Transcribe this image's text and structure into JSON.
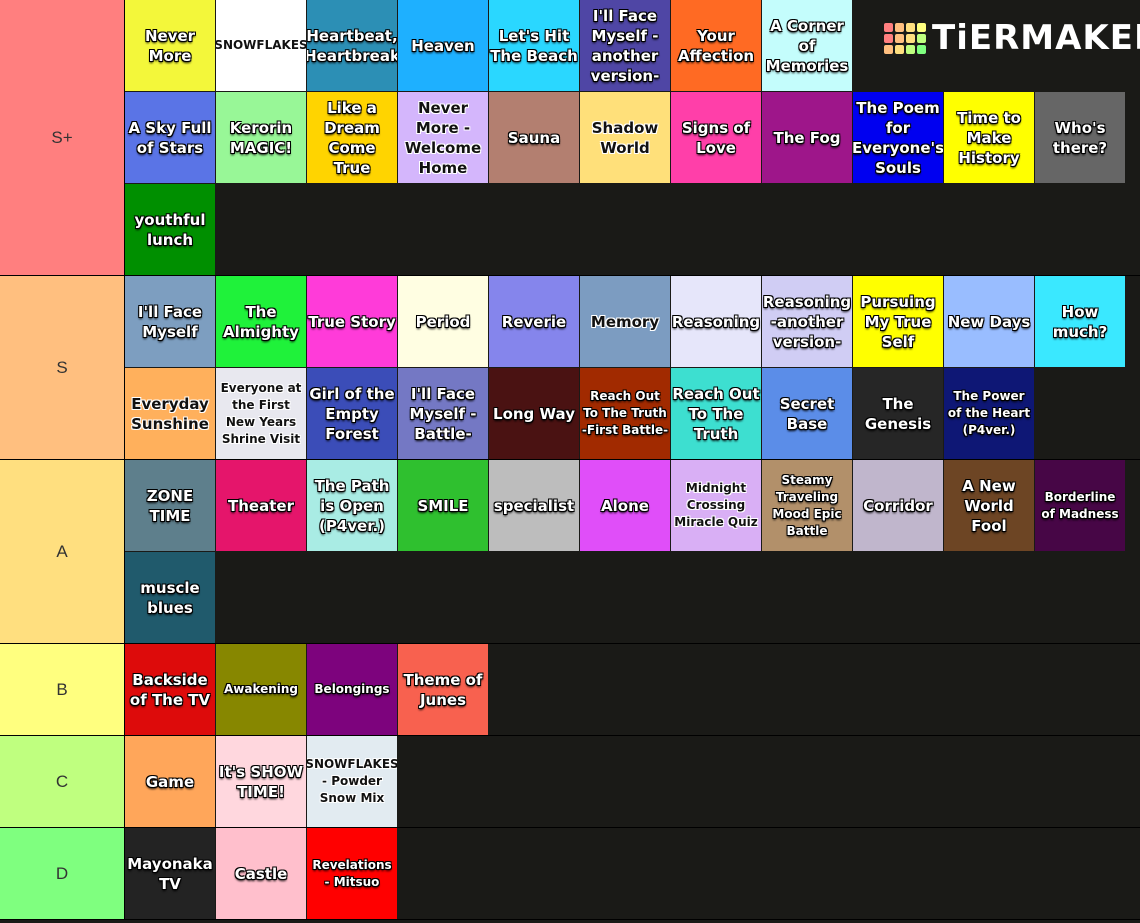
{
  "logo": {
    "text": "TiERMAKER",
    "colors": [
      "#ff7f7f",
      "#ffbf7f",
      "#ffdf7f",
      "#ffff7f",
      "#ff7f7f",
      "#ffbf7f",
      "#ffdf7f",
      "#bfff7f",
      "#ffbf7f",
      "#ffdf7f",
      "#bfff7f",
      "#7fff7f"
    ]
  },
  "tiers": [
    {
      "label": "S+",
      "color": "#ff7f7f",
      "rows": 3,
      "tiles": [
        {
          "t": "Never More",
          "bg": "#f3f73a"
        },
        {
          "t": "SNOWFLAKES",
          "bg": "#ffffff",
          "dark": true,
          "small": true
        },
        {
          "t": "Heartbeat, Heartbreak",
          "bg": "#2c8fb5"
        },
        {
          "t": "Heaven",
          "bg": "#1eb0ff"
        },
        {
          "t": "Let's Hit The Beach",
          "bg": "#2ad7ff"
        },
        {
          "t": "I'll Face Myself -another version-",
          "bg": "#4f46a5"
        },
        {
          "t": "Your Affection",
          "bg": "#ff6a23"
        },
        {
          "t": "A Corner of Memories",
          "bg": "#c4fdfc"
        },
        {
          "t": "",
          "bg": "#1a1a17"
        },
        {
          "t": "",
          "bg": "#1a1a17"
        },
        {
          "t": "",
          "bg": "#1a1a17"
        },
        {
          "t": "A Sky Full of Stars",
          "bg": "#5a74e6"
        },
        {
          "t": "Kerorin MAGIC!",
          "bg": "#98f797"
        },
        {
          "t": "Like a Dream Come True",
          "bg": "#ffd400"
        },
        {
          "t": "Never More - Welcome Home",
          "bg": "#d4b6fc",
          "dark": true
        },
        {
          "t": "Sauna",
          "bg": "#b37f70"
        },
        {
          "t": "Shadow World",
          "bg": "#ffe07a",
          "dark": true
        },
        {
          "t": "Signs of Love",
          "bg": "#ff3fa9"
        },
        {
          "t": "The Fog",
          "bg": "#9e168a"
        },
        {
          "t": "The Poem for Everyone's Souls",
          "bg": "#0000f0"
        },
        {
          "t": "Time to Make History",
          "bg": "#ffff00"
        },
        {
          "t": "Who's there?",
          "bg": "#666666"
        },
        {
          "t": "youthful lunch",
          "bg": "#008f00"
        }
      ]
    },
    {
      "label": "S",
      "color": "#ffbf7f",
      "rows": 2,
      "tiles": [
        {
          "t": "I'll Face Myself",
          "bg": "#7d9ec0"
        },
        {
          "t": "The Almighty",
          "bg": "#1ff23a"
        },
        {
          "t": "True Story",
          "bg": "#ff3bd9"
        },
        {
          "t": "Period",
          "bg": "#fffee2"
        },
        {
          "t": "Reverie",
          "bg": "#8585ec"
        },
        {
          "t": "Memory",
          "bg": "#7c9cc1",
          "dark": true
        },
        {
          "t": "Reasoning",
          "bg": "#e6e6fa"
        },
        {
          "t": "Reasoning -another version-",
          "bg": "#d0cdf4"
        },
        {
          "t": "Pursuing My True Self",
          "bg": "#ffff00"
        },
        {
          "t": "New Days",
          "bg": "#99bdff"
        },
        {
          "t": "How much?",
          "bg": "#3ae8ff"
        },
        {
          "t": "Everyday Sunshine",
          "bg": "#ffb05c",
          "dark": true
        },
        {
          "t": "Everyone at the First New Years Shrine Visit",
          "bg": "#e8e8ef",
          "dark": true,
          "small": true
        },
        {
          "t": "Girl of the Empty Forest",
          "bg": "#3b4db8"
        },
        {
          "t": "I'll Face Myself -Battle-",
          "bg": "#7478c4"
        },
        {
          "t": "Long Way",
          "bg": "#4a1212"
        },
        {
          "t": "Reach Out To The Truth -First Battle-",
          "bg": "#a12a00",
          "small": true
        },
        {
          "t": "Reach Out To The Truth",
          "bg": "#3ddfd0"
        },
        {
          "t": "Secret Base",
          "bg": "#5b8de8"
        },
        {
          "t": "The Genesis",
          "bg": "#262626"
        },
        {
          "t": "The Power of the Heart (P4ver.)",
          "bg": "#0e1775",
          "small": true
        }
      ]
    },
    {
      "label": "A",
      "color": "#ffdf7f",
      "rows": 2,
      "tiles": [
        {
          "t": "ZONE TIME",
          "bg": "#5e7f8c"
        },
        {
          "t": "Theater",
          "bg": "#e5156b"
        },
        {
          "t": "The Path is Open (P4ver.)",
          "bg": "#a9ece4"
        },
        {
          "t": "SMILE",
          "bg": "#2fc02f"
        },
        {
          "t": "specialist",
          "bg": "#bdbdbd"
        },
        {
          "t": "Alone",
          "bg": "#e04ef9"
        },
        {
          "t": "Midnight Crossing Miracle Quiz",
          "bg": "#d9aff5",
          "dark": true,
          "small": true
        },
        {
          "t": "Steamy Traveling Mood Epic Battle",
          "bg": "#b2906a",
          "small": true
        },
        {
          "t": "Corridor",
          "bg": "#c0b6cc"
        },
        {
          "t": "A New World Fool",
          "bg": "#6d4524"
        },
        {
          "t": "Borderline of Madness",
          "bg": "#470646",
          "small": true
        },
        {
          "t": "muscle blues",
          "bg": "#205a6c"
        }
      ]
    },
    {
      "label": "B",
      "color": "#ffff7f",
      "rows": 1,
      "tiles": [
        {
          "t": "Backside of The TV",
          "bg": "#dd0b0b"
        },
        {
          "t": "Awakening",
          "bg": "#878700",
          "small": true
        },
        {
          "t": "Belongings",
          "bg": "#7d037d",
          "small": true
        },
        {
          "t": "Theme of Junes",
          "bg": "#f8614f"
        }
      ]
    },
    {
      "label": "C",
      "color": "#bfff7f",
      "rows": 1,
      "tiles": [
        {
          "t": "Game",
          "bg": "#ffa65a"
        },
        {
          "t": "It's SHOW TIME!",
          "bg": "#ffd7de"
        },
        {
          "t": "SNOWFLAKES - Powder Snow Mix",
          "bg": "#e2ebf1",
          "dark": true,
          "small": true
        }
      ]
    },
    {
      "label": "D",
      "color": "#7fff7f",
      "rows": 1,
      "tiles": [
        {
          "t": "Mayonaka TV",
          "bg": "#232323"
        },
        {
          "t": "Castle",
          "bg": "#ffbfcc"
        },
        {
          "t": "Revelations - Mitsuo",
          "bg": "#ff0000",
          "small": true
        }
      ]
    }
  ]
}
